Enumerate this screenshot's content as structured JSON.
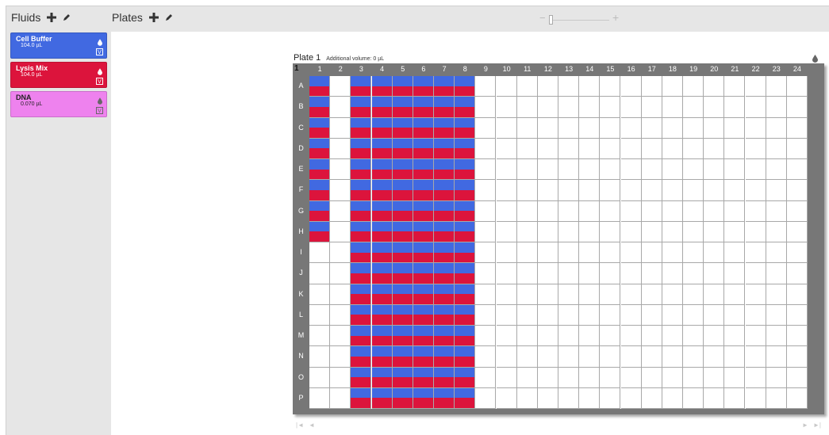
{
  "header": {
    "fluids_label": "Fluids",
    "plates_label": "Plates",
    "zoom_minus": "−",
    "zoom_plus": "+"
  },
  "fluids": [
    {
      "name": "Cell Buffer",
      "volume": "104.0 µL",
      "color": "#4169e1",
      "text_color": "#ffffff",
      "v_label": "V"
    },
    {
      "name": "Lysis Mix",
      "volume": "104.0 µL",
      "color": "#dc143c",
      "text_color": "#ffffff",
      "v_label": "V"
    },
    {
      "name": "DNA",
      "volume": "0.070 µL",
      "color": "#ee82ee",
      "text_color": "#222222",
      "v_label": "V"
    }
  ],
  "plate": {
    "title": "Plate 1",
    "additional_volume": "Additional volume: 0 µL",
    "corner_label": "1",
    "columns": [
      "1",
      "2",
      "3",
      "4",
      "5",
      "6",
      "7",
      "8",
      "9",
      "10",
      "11",
      "12",
      "13",
      "14",
      "15",
      "16",
      "17",
      "18",
      "19",
      "20",
      "21",
      "22",
      "23",
      "24"
    ],
    "rows": [
      "A",
      "B",
      "C",
      "D",
      "E",
      "F",
      "G",
      "H",
      "I",
      "J",
      "K",
      "L",
      "M",
      "N",
      "O",
      "P"
    ],
    "filled_wells": [
      {
        "column": "1",
        "rows": [
          "A",
          "B",
          "C",
          "D",
          "E",
          "F",
          "G",
          "H"
        ],
        "fluids": [
          "Cell Buffer",
          "Lysis Mix"
        ]
      },
      {
        "column": "3",
        "rows": [
          "A",
          "B",
          "C",
          "D",
          "E",
          "F",
          "G",
          "H",
          "I",
          "J",
          "K",
          "L",
          "M",
          "N",
          "O",
          "P"
        ],
        "fluids": [
          "Cell Buffer",
          "Lysis Mix"
        ]
      },
      {
        "column": "4",
        "rows": [
          "A",
          "B",
          "C",
          "D",
          "E",
          "F",
          "G",
          "H",
          "I",
          "J",
          "K",
          "L",
          "M",
          "N",
          "O",
          "P"
        ],
        "fluids": [
          "Cell Buffer",
          "Lysis Mix"
        ]
      },
      {
        "column": "5",
        "rows": [
          "A",
          "B",
          "C",
          "D",
          "E",
          "F",
          "G",
          "H",
          "I",
          "J",
          "K",
          "L",
          "M",
          "N",
          "O",
          "P"
        ],
        "fluids": [
          "Cell Buffer",
          "Lysis Mix"
        ]
      },
      {
        "column": "6",
        "rows": [
          "A",
          "B",
          "C",
          "D",
          "E",
          "F",
          "G",
          "H",
          "I",
          "J",
          "K",
          "L",
          "M",
          "N",
          "O",
          "P"
        ],
        "fluids": [
          "Cell Buffer",
          "Lysis Mix"
        ]
      },
      {
        "column": "7",
        "rows": [
          "A",
          "B",
          "C",
          "D",
          "E",
          "F",
          "G",
          "H",
          "I",
          "J",
          "K",
          "L",
          "M",
          "N",
          "O",
          "P"
        ],
        "fluids": [
          "Cell Buffer",
          "Lysis Mix"
        ]
      },
      {
        "column": "8",
        "rows": [
          "A",
          "B",
          "C",
          "D",
          "E",
          "F",
          "G",
          "H",
          "I",
          "J",
          "K",
          "L",
          "M",
          "N",
          "O",
          "P"
        ],
        "fluids": [
          "Cell Buffer",
          "Lysis Mix"
        ]
      }
    ]
  },
  "nav": {
    "first": "|◄",
    "prev": "◄",
    "next": "►",
    "last": "►|"
  },
  "icons": {
    "add": "plus-icon",
    "edit": "pencil-icon",
    "drop": "drop-icon",
    "view": "v-icon"
  }
}
